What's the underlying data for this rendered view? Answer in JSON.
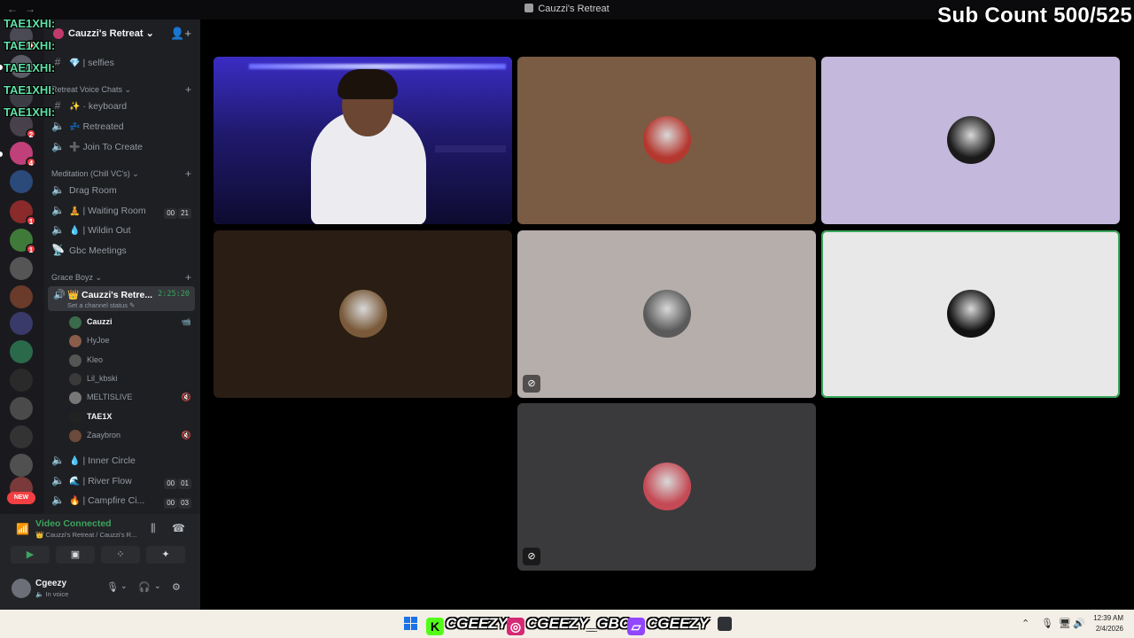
{
  "window": {
    "title": "Cauzzi's Retreat"
  },
  "overlay": {
    "sub_count": "Sub Count 500/525",
    "tags": [
      "TAE1XHI:",
      "TAE1XHI:",
      "TAE1XHI:",
      "TAE1XHI:",
      "TAE1XHI:"
    ]
  },
  "server_list": {
    "badges": [
      "26",
      "2",
      "4",
      "1",
      "1"
    ],
    "new_label": "NEW"
  },
  "server": {
    "name": "Cauzzi's Retreat"
  },
  "channels": {
    "selfies": "| selfies",
    "cat_retreat": "Retreat Voice Chats",
    "keyboard": "· keyboard",
    "retreated": "Retreated",
    "join_to_create": "Join To Create",
    "cat_meditation": "Meditation (Chill VC's)",
    "drag_room": "Drag Room",
    "waiting_room": "| Waiting Room",
    "waiting_room_count": [
      "00",
      "21"
    ],
    "wildin_out": "| Wildin Out",
    "gbc_meetings": "Gbc Meetings",
    "cat_grace": "Grace Boyz",
    "active": {
      "name": "Cauzzi's Retre...",
      "status": "Set a channel status",
      "timer": "2:25:20"
    },
    "members": [
      {
        "name": "Cauzzi",
        "bold": true,
        "color": "#3a6b4a"
      },
      {
        "name": "HyJoe",
        "bold": false,
        "color": "#8a5c4a"
      },
      {
        "name": "Kleo",
        "bold": false,
        "color": "#555"
      },
      {
        "name": "Lil_kbski",
        "bold": false,
        "color": "#3a3a3a"
      },
      {
        "name": "MELTISLIVE",
        "bold": false,
        "color": "#777"
      },
      {
        "name": "TAE1X",
        "bold": true,
        "color": "#222"
      },
      {
        "name": "Zaaybron",
        "bold": false,
        "color": "#6a4a3a"
      }
    ],
    "inner_circle": "| Inner Circle",
    "river_flow": "| River Flow",
    "river_flow_count": [
      "00",
      "01"
    ],
    "campfire": "| Campfire Ci...",
    "campfire_count": [
      "00",
      "03"
    ]
  },
  "voice": {
    "status": "Video Connected",
    "location": "Cauzzi's Retreat / Cauzzi's R..."
  },
  "user": {
    "name": "Cgeezy",
    "status": "In voice"
  },
  "tiles": [
    {
      "kind": "camera",
      "speaking": true,
      "bg": "#1e1a6e"
    },
    {
      "kind": "avatar",
      "bg": "#7a5b44",
      "avatar": "#b5382f",
      "muted": false
    },
    {
      "kind": "avatar",
      "bg": "#c4b8dc",
      "avatar": "#1a1a1a",
      "muted": false
    },
    {
      "kind": "avatar",
      "bg": "#2a1d13",
      "avatar": "#7a5a3a",
      "muted": false
    },
    {
      "kind": "avatar",
      "bg": "#b6aeab",
      "avatar": "#5a5a5a",
      "muted": true
    },
    {
      "kind": "avatar",
      "bg": "#e8e8e8",
      "avatar": "#121212",
      "muted": false,
      "speaking": true
    },
    {
      "kind": "avatar",
      "bg": "#3a3a3c",
      "avatar": "#c44a55",
      "muted": true
    }
  ],
  "taskbar": {
    "brand_kick": "CGEEZY",
    "brand_ig": "CGEEZY_GBC",
    "brand_twitch": "CGEEZY",
    "time": "12:39 AM",
    "date": "2/4/2026"
  }
}
